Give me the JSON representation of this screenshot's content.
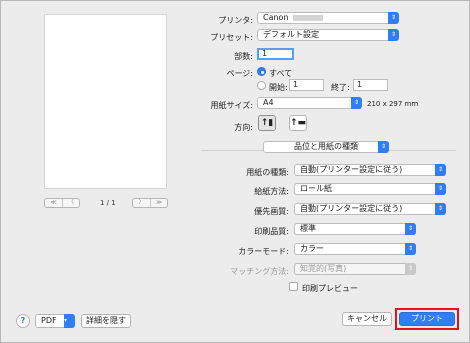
{
  "preview": {
    "nav_first": "≪",
    "nav_prev": "〈",
    "nav_next": "〉",
    "nav_last": "≫",
    "page_indicator": "1 / 1"
  },
  "printer": {
    "label": "プリンタ:",
    "value": "Canon"
  },
  "preset": {
    "label": "プリセット:",
    "value": "デフォルト設定"
  },
  "copies": {
    "label": "部数:",
    "value": "1"
  },
  "pages": {
    "label": "ページ:",
    "all_label": "すべて",
    "from_label": "開始:",
    "from_value": "1",
    "to_label": "終了:",
    "to_value": "1"
  },
  "paper_size": {
    "label": "用紙サイズ:",
    "value": "A4",
    "dimensions": "210 x 297 mm"
  },
  "orientation": {
    "label": "方向:",
    "portrait_icon": "portrait-icon",
    "landscape_icon": "landscape-icon"
  },
  "section": {
    "value": "品位と用紙の種類"
  },
  "media_type": {
    "label": "用紙の種類:",
    "value": "自動(プリンター設定に従う)"
  },
  "paper_source": {
    "label": "給紙方法:",
    "value": "ロール紙"
  },
  "priority_quality": {
    "label": "優先画質:",
    "value": "自動(プリンター設定に従う)"
  },
  "print_quality": {
    "label": "印刷品質:",
    "value": "標準"
  },
  "color_mode": {
    "label": "カラーモード:",
    "value": "カラー"
  },
  "matching": {
    "label": "マッチング方法:",
    "value": "知覚的(写真)"
  },
  "print_preview": {
    "label": "印刷プレビュー"
  },
  "footer": {
    "help": "?",
    "pdf": "PDF",
    "hide_details": "詳細を隠す",
    "cancel": "キャンセル",
    "print": "プリント"
  },
  "colors": {
    "accent": "#2f7ef7",
    "highlight": "#e0141a"
  }
}
